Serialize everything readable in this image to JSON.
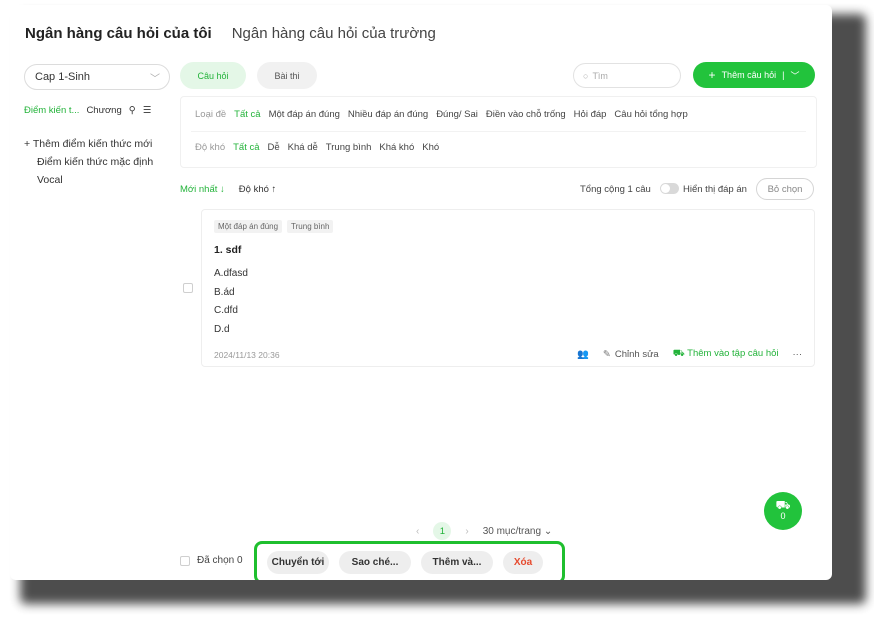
{
  "tabs": {
    "mine": "Ngân hàng câu hỏi của tôi",
    "school": "Ngân hàng câu hỏi của trường"
  },
  "subject_select": {
    "value": "Cap 1-Sinh"
  },
  "type_tabs": {
    "questions": "Câu hỏi",
    "exams": "Bài thi"
  },
  "search": {
    "placeholder": "Tìm"
  },
  "add_button": {
    "label": "Thêm câu hỏi",
    "separator": "|"
  },
  "knowledge_panel": {
    "tab_points": "Điểm kiến t...",
    "tab_chapter": "Chương",
    "add_label": "Thêm điểm kiến thức mới",
    "items": [
      "Điểm kiến thức mặc định",
      "Vocal"
    ]
  },
  "filters": {
    "type_label": "Loại đề",
    "type_options": [
      "Tất cả",
      "Một đáp án đúng",
      "Nhiều đáp án đúng",
      "Đúng/ Sai",
      "Điền vào chỗ trống",
      "Hỏi đáp",
      "Câu hỏi tổng hợp"
    ],
    "difficulty_label": "Độ khó",
    "difficulty_options": [
      "Tất cả",
      "Dễ",
      "Khá dễ",
      "Trung bình",
      "Khá khó",
      "Khó"
    ]
  },
  "sort": {
    "newest": "Mới nhất ↓",
    "difficulty": "Độ khó ↑"
  },
  "summary": {
    "total": "Tổng cộng 1 câu",
    "show_answer": "Hiển thị đáp án",
    "deselect": "Bỏ chọn"
  },
  "question": {
    "tags": [
      "Một đáp án đúng",
      "Trung bình"
    ],
    "title": "1. sdf",
    "options": [
      "A.dfasd",
      "B.ád",
      "C.dfd",
      "D.d"
    ],
    "time": "2024/11/13 20:36",
    "actions": {
      "edit": "Chỉnh sửa",
      "add_to_set": "Thêm vào tập câu hỏi",
      "more": "···"
    }
  },
  "pagination": {
    "current": "1",
    "per_page": "30 mục/trang"
  },
  "basket": {
    "count": "0"
  },
  "bottom_bar": {
    "selected": "Đã chọn 0",
    "move": "Chuyển tới",
    "copy": "Sao ché...",
    "add": "Thêm và...",
    "delete": "Xóa"
  },
  "colors": {
    "accent": "#22c33c",
    "delete": "#e64a2e",
    "highlight_border": "#1fbf2e"
  }
}
